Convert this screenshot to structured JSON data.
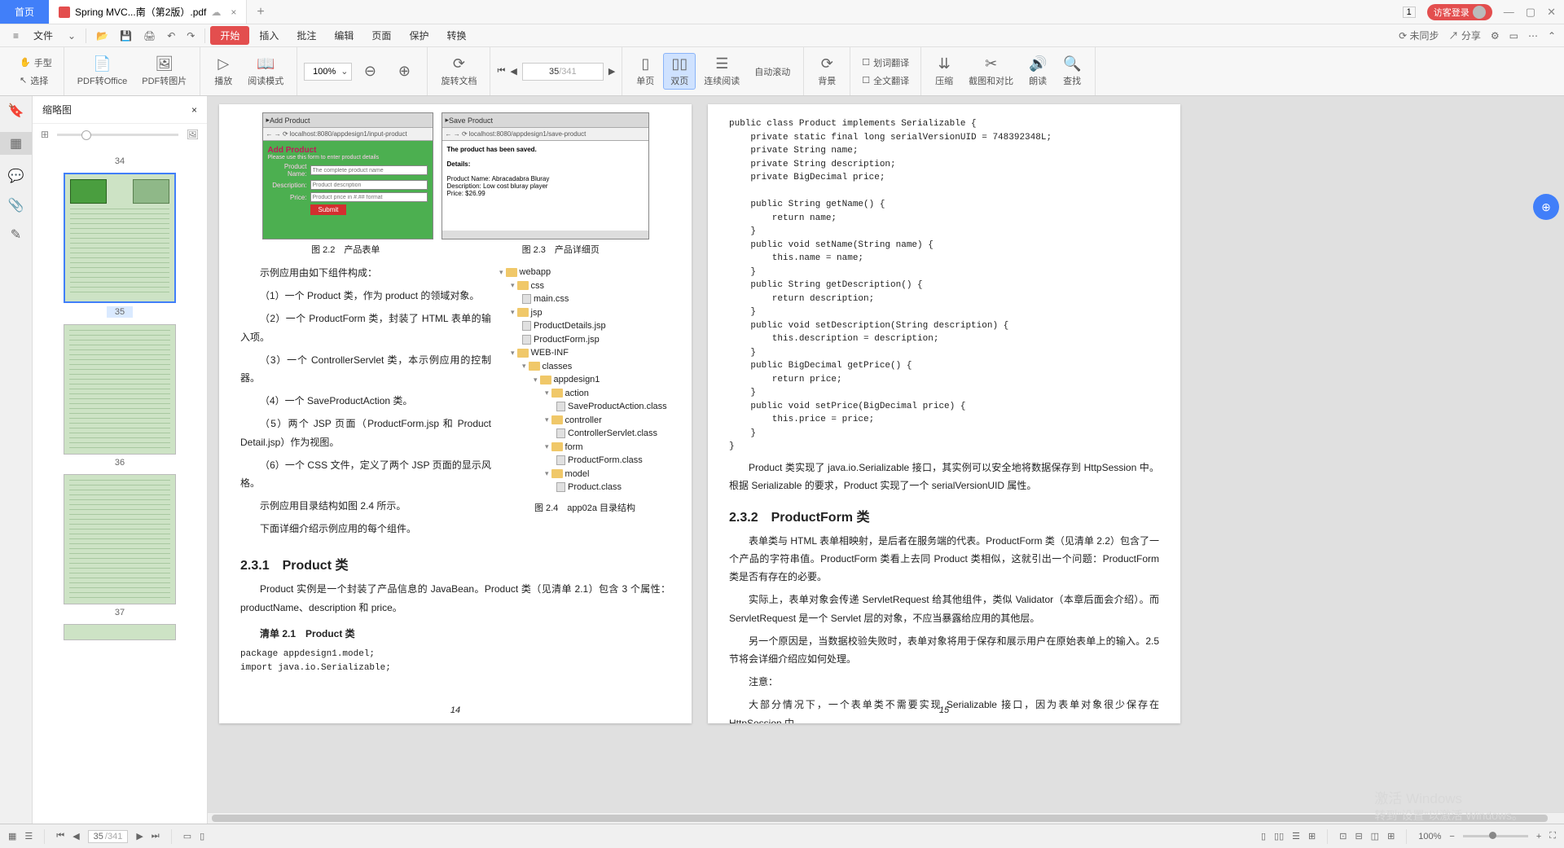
{
  "titlebar": {
    "home": "首页",
    "doc_name": "Spring MVC...南（第2版）.pdf",
    "login": "访客登录",
    "one": "1"
  },
  "menubar": {
    "file": "文件",
    "start": "开始",
    "insert": "插入",
    "review": "批注",
    "edit": "编辑",
    "page": "页面",
    "protect": "保护",
    "convert": "转换",
    "unsync": "未同步",
    "share": "分享"
  },
  "toolbar": {
    "hand": "手型",
    "select": "选择",
    "pdf2office": "PDF转Office",
    "pdf2img": "PDF转图片",
    "play": "播放",
    "readmode": "阅读模式",
    "zoom": "100%",
    "rotate": "旋转文档",
    "single": "单页",
    "double": "双页",
    "continuous": "连续阅读",
    "autoscroll": "自动滚动",
    "background": "背景",
    "wordtrans": "划词翻译",
    "fulltrans": "全文翻译",
    "compress": "压缩",
    "screenshot": "截图和对比",
    "read": "朗读",
    "find": "查找",
    "cur_page": "35",
    "total_page": "/341"
  },
  "thumbs": {
    "title": "缩略图",
    "p34": "34",
    "p35": "35",
    "p36": "36",
    "p37": "37"
  },
  "page_left": {
    "fig22": "图 2.2　产品表单",
    "fig23": "图 2.3　产品详细页",
    "intro": "示例应用由如下组件构成：",
    "li1": "（1）一个 Product 类，作为 product 的领域对象。",
    "li2": "（2）一个 ProductForm 类，封装了 HTML 表单的输入项。",
    "li3": "（3）一个 ControllerServlet 类，本示例应用的控制器。",
    "li4": "（4）一个 SaveProductAction 类。",
    "li5": "（5）两个 JSP 页面（ProductForm.jsp 和 Product Detail.jsp）作为视图。",
    "li6": "（6）一个 CSS 文件，定义了两个 JSP 页面的显示风格。",
    "p1": "示例应用目录结构如图 2.4 所示。",
    "p2": "下面详细介绍示例应用的每个组件。",
    "h231": "2.3.1　Product 类",
    "p3": "Product 实例是一个封装了产品信息的 JavaBean。Product 类（见清单 2.1）包含 3 个属性：productName、description 和 price。",
    "listing21": "清单 2.1　Product 类",
    "code1": "package appdesign1.model;\nimport java.io.Serializable;",
    "pagenum": "14",
    "fig24": "图 2.4　app02a 目录结构",
    "addprod": "Add Product",
    "addprod_sub": "Please use this form to enter product details",
    "fld_name": "Product Name:",
    "fld_desc": "Description:",
    "fld_price": "Price:",
    "ph_name": "The complete product name",
    "ph_desc": "Product description",
    "ph_price": "Product price in #.## format",
    "submit": "Submit",
    "url1": "localhost:8080/appdesign1/input-product",
    "tab1": "Add Product",
    "tab2": "Save Product",
    "url2": "localhost:8080/appdesign1/save-product",
    "saved": "The product has been saved.",
    "details": "Details:",
    "d_name": "Product Name: Abracadabra Bluray",
    "d_desc": "Description: Low cost bluray player",
    "d_price": "Price: $26.99",
    "tree": {
      "webapp": "webapp",
      "css": "css",
      "maincss": "main.css",
      "jsp": "jsp",
      "pd_jsp": "ProductDetails.jsp",
      "pf_jsp": "ProductForm.jsp",
      "webinf": "WEB-INF",
      "classes": "classes",
      "appd1": "appdesign1",
      "action": "action",
      "spa": "SaveProductAction.class",
      "controller": "controller",
      "cs": "ControllerServlet.class",
      "form": "form",
      "pfc": "ProductForm.class",
      "model": "model",
      "pc": "Product.class"
    }
  },
  "page_right": {
    "code": "public class Product implements Serializable {\n    private static final long serialVersionUID = 748392348L;\n    private String name;\n    private String description;\n    private BigDecimal price;\n\n    public String getName() {\n        return name;\n    }\n    public void setName(String name) {\n        this.name = name;\n    }\n    public String getDescription() {\n        return description;\n    }\n    public void setDescription(String description) {\n        this.description = description;\n    }\n    public BigDecimal getPrice() {\n        return price;\n    }\n    public void setPrice(BigDecimal price) {\n        this.price = price;\n    }\n}",
    "p1": "Product 类实现了 java.io.Serializable 接口，其实例可以安全地将数据保存到 HttpSession 中。根据 Serializable 的要求，Product 实现了一个 serialVersionUID 属性。",
    "h232": "2.3.2　ProductForm 类",
    "p2": "表单类与 HTML 表单相映射，是后者在服务端的代表。ProductForm 类（见清单 2.2）包含了一个产品的字符串值。ProductForm 类看上去同 Product 类相似，这就引出一个问题：ProductForm 类是否有存在的必要。",
    "p3": "实际上，表单对象会传递 ServletRequest 给其他组件，类似 Validator（本章后面会介绍）。而 ServletRequest 是一个 Servlet 层的对象，不应当暴露给应用的其他层。",
    "p4": "另一个原因是，当数据校验失败时，表单对象将用于保存和展示用户在原始表单上的输入。2.5 节将会详细介绍应如何处理。",
    "note": "注意：",
    "p5": "大部分情况下，一个表单类不需要实现 Serializable 接口，因为表单对象很少保存在 HttpSession 中。",
    "pagenum": "15"
  },
  "statusbar": {
    "cur": "35",
    "tot": "/341",
    "zoom": "100%"
  },
  "watermark": {
    "l1": "激活 Windows",
    "l2": "转到\"设置\"以激活 Windows。"
  }
}
